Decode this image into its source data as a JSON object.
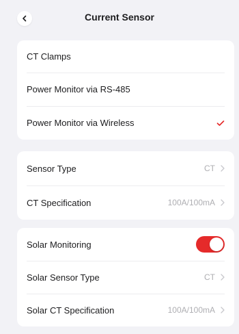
{
  "header": {
    "title": "Current Sensor",
    "back_icon": "chevron-left-icon"
  },
  "sensor_source": {
    "options": [
      {
        "label": "CT Clamps",
        "selected": false
      },
      {
        "label": "Power Monitor via RS-485",
        "selected": false
      },
      {
        "label": "Power Monitor via Wireless",
        "selected": true
      }
    ],
    "check_color": "#e52a2a"
  },
  "sensor_settings": {
    "sensor_type": {
      "label": "Sensor Type",
      "value": "CT"
    },
    "ct_spec": {
      "label": "CT Specification",
      "value": "100A/100mA"
    }
  },
  "solar": {
    "monitoring": {
      "label": "Solar Monitoring",
      "enabled": true,
      "toggle_color": "#e52a2a"
    },
    "sensor_type": {
      "label": "Solar Sensor Type",
      "value": "CT"
    },
    "ct_spec": {
      "label": "Solar CT Specification",
      "value": "100A/100mA"
    }
  }
}
